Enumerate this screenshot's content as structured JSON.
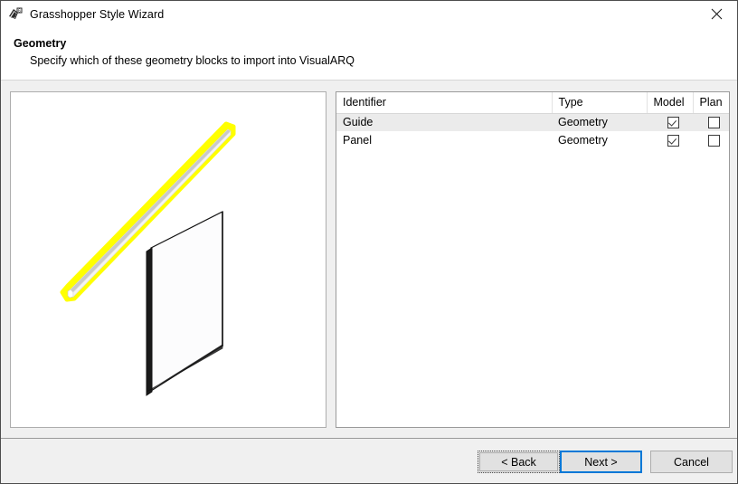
{
  "window": {
    "title": "Grasshopper Style Wizard",
    "icon": "grasshopper-icon",
    "close_label": "Close"
  },
  "header": {
    "title": "Geometry",
    "subtitle": "Specify which of these geometry blocks to import into VisualARQ"
  },
  "preview": {
    "name": "geometry-preview",
    "objects": [
      {
        "label": "Guide",
        "highlight_color": "#ffff00",
        "selected": true
      },
      {
        "label": "Panel",
        "highlight_color": "#000000",
        "selected": false
      }
    ],
    "background_color": "#ffffff"
  },
  "table": {
    "columns": [
      {
        "key": "identifier",
        "label": "Identifier"
      },
      {
        "key": "type",
        "label": "Type"
      },
      {
        "key": "model",
        "label": "Model"
      },
      {
        "key": "plan",
        "label": "Plan"
      }
    ],
    "rows": [
      {
        "identifier": "Guide",
        "type": "Geometry",
        "model": true,
        "plan": false,
        "selected": true
      },
      {
        "identifier": "Panel",
        "type": "Geometry",
        "model": true,
        "plan": false,
        "selected": false
      }
    ]
  },
  "footer": {
    "back_label": "< Back",
    "next_label": "Next >",
    "cancel_label": "Cancel",
    "accent_color": "#0078d7"
  }
}
